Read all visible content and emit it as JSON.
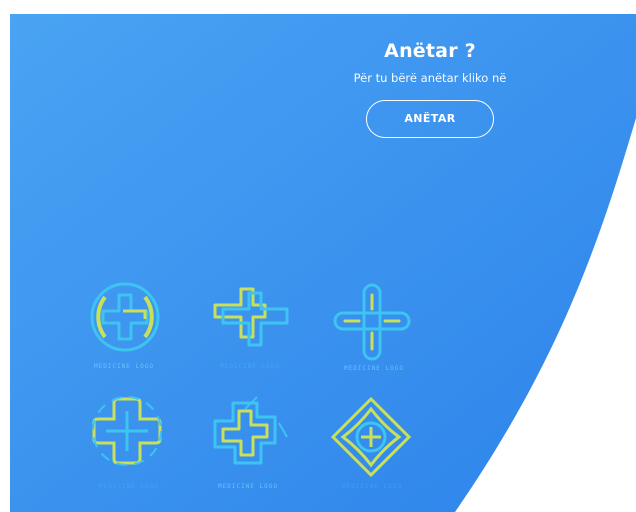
{
  "member_section": {
    "title": "Anëtar ?",
    "subtitle": "Për tu bërë anëtar kliko në",
    "button_label": "ANËTAR"
  },
  "logos": [
    {
      "caption": "MEDICINE LOGO",
      "icon": "circle-plus-logo-icon"
    },
    {
      "caption": "MEDICINE LOGO",
      "icon": "interlocked-plus-logo-icon"
    },
    {
      "caption": "MEDICINE LOGO",
      "icon": "rounded-plus-logo-icon"
    },
    {
      "caption": "MEDICINE LOGO",
      "icon": "double-plus-logo-icon"
    },
    {
      "caption": "MEDICINE LOGO",
      "icon": "maze-plus-logo-icon"
    },
    {
      "caption": "MEDICINE LOGO",
      "icon": "diamond-plus-logo-icon"
    }
  ],
  "colors": {
    "panel_blue_light": "#4aa0f2",
    "panel_blue": "#2f86ea",
    "logo_green": "#c8e05a",
    "logo_cyan": "#3ec4f0",
    "text": "#ffffff"
  }
}
